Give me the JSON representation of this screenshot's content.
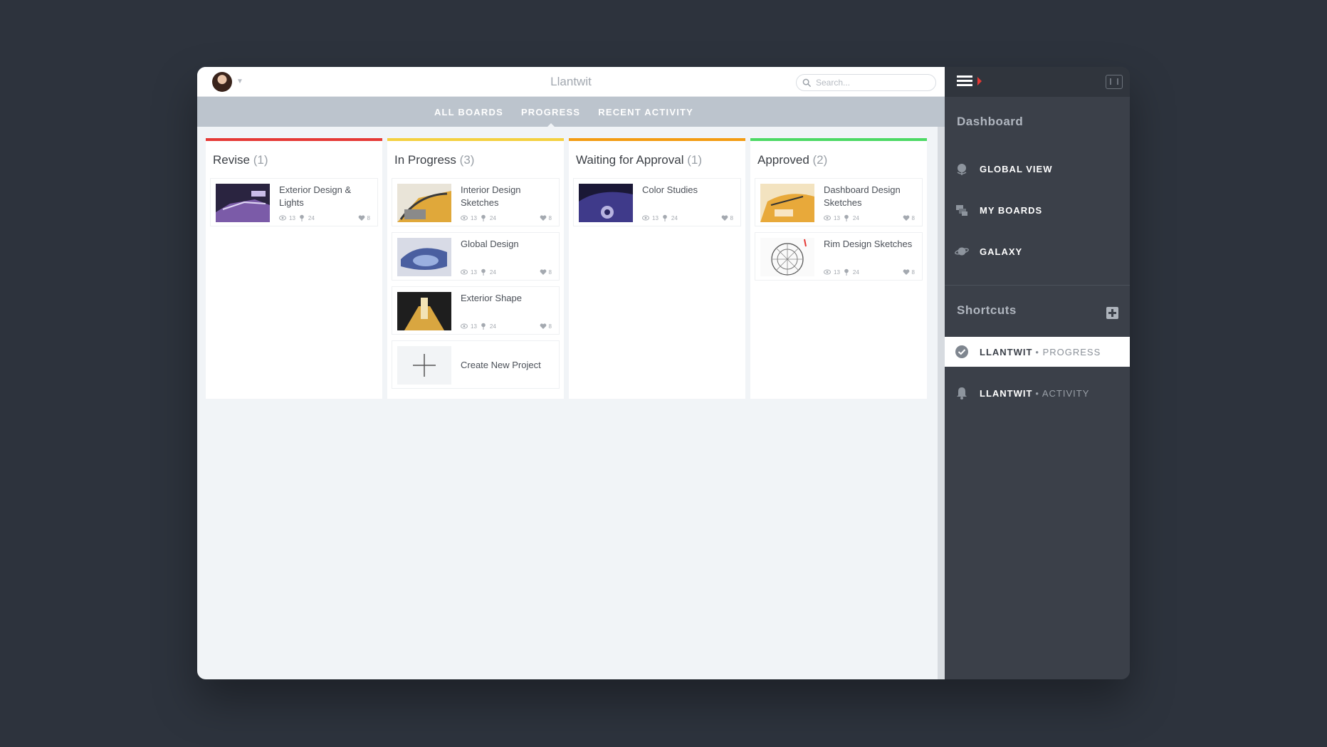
{
  "app": {
    "title": "Llantwit"
  },
  "search": {
    "placeholder": "Search..."
  },
  "tabs": [
    {
      "label": "ALL BOARDS"
    },
    {
      "label": "PROGRESS"
    },
    {
      "label": "RECENT ACTIVITY"
    }
  ],
  "columns": [
    {
      "title": "Revise",
      "count": "(1)",
      "color": "#e53935",
      "cards": [
        {
          "title": "Exterior Design & Lights",
          "views": "13",
          "comments": "24",
          "likes": "8"
        }
      ]
    },
    {
      "title": "In Progress",
      "count": "(3)",
      "color": "#f4d03f",
      "cards": [
        {
          "title": "Interior Design Sketches",
          "views": "13",
          "comments": "24",
          "likes": "8"
        },
        {
          "title": "Global Design",
          "views": "13",
          "comments": "24",
          "likes": "8"
        },
        {
          "title": "Exterior Shape",
          "views": "13",
          "comments": "24",
          "likes": "8"
        }
      ],
      "create_label": "Create New Project"
    },
    {
      "title": "Waiting for Approval",
      "count": "(1)",
      "color": "#f39c12",
      "cards": [
        {
          "title": "Color Studies",
          "views": "13",
          "comments": "24",
          "likes": "8"
        }
      ]
    },
    {
      "title": "Approved",
      "count": "(2)",
      "color": "#4cd964",
      "cards": [
        {
          "title": "Dashboard Design Sketches",
          "views": "13",
          "comments": "24",
          "likes": "8"
        },
        {
          "title": "Rim Design Sketches",
          "views": "13",
          "comments": "24",
          "likes": "8"
        }
      ]
    }
  ],
  "sidebar": {
    "dashboard_heading": "Dashboard",
    "nav": [
      {
        "label": "GLOBAL VIEW",
        "icon": "globe-icon"
      },
      {
        "label": "MY BOARDS",
        "icon": "boards-icon"
      },
      {
        "label": "GALAXY",
        "icon": "planet-icon"
      }
    ],
    "shortcuts_heading": "Shortcuts",
    "shortcuts": [
      {
        "label": "LLANTWIT",
        "sub": "• PROGRESS",
        "icon": "check-circle-icon",
        "active": true
      },
      {
        "label": "LLANTWIT",
        "sub": "• ACTIVITY",
        "icon": "bell-icon",
        "active": false
      }
    ]
  }
}
